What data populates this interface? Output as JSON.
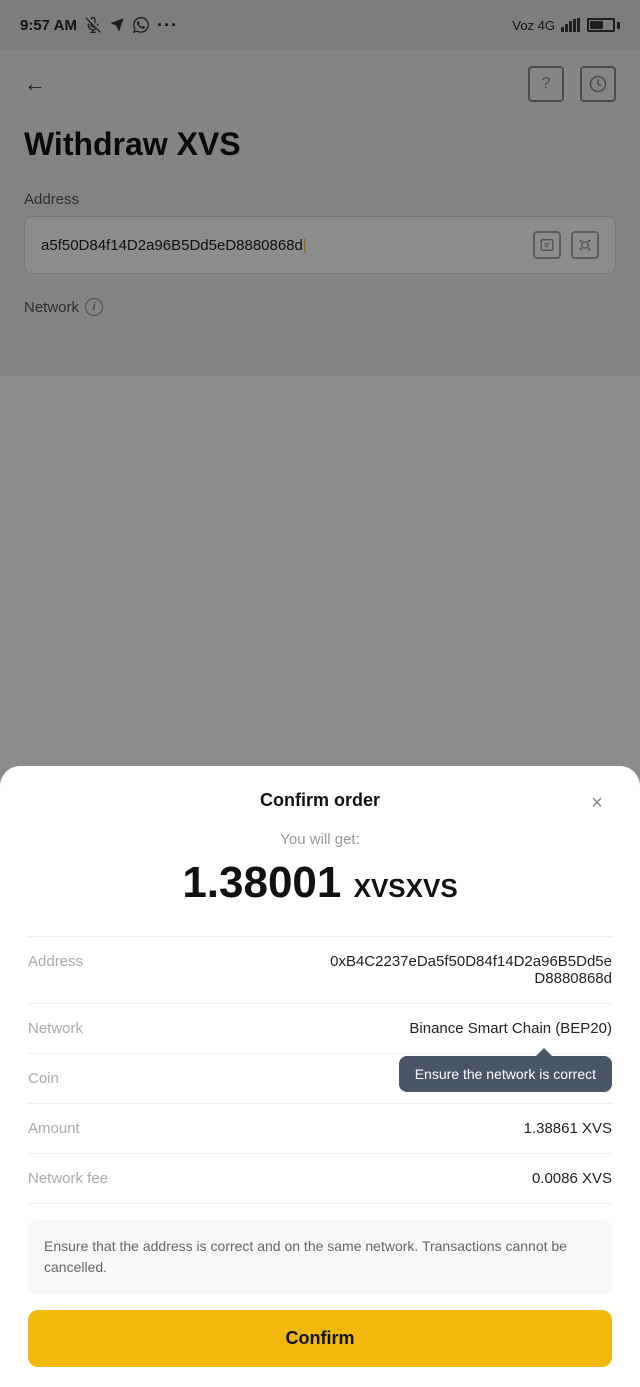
{
  "statusBar": {
    "time": "9:57 AM",
    "carrier": "Voz 4G",
    "battery": "60"
  },
  "page": {
    "title": "Withdraw XVS",
    "addressLabel": "Address",
    "addressValue": "a5f50D84f14D2a96B5Dd5eD8880868d",
    "networkLabel": "Network",
    "infoIcon": "i"
  },
  "modal": {
    "title": "Confirm order",
    "closeLabel": "×",
    "youWillGet": "You will get:",
    "amount": "1.38001",
    "currency": "XVS",
    "rows": [
      {
        "key": "Address",
        "value": "0xB4C2237eDa5f50D84f14D2a96B5Dd5eD8880868d"
      },
      {
        "key": "Network",
        "value": "Binance Smart Chain (BEP20)"
      },
      {
        "key": "Coin",
        "value": "XVS"
      },
      {
        "key": "Amount",
        "value": "1.38861 XVS"
      },
      {
        "key": "Network fee",
        "value": "0.0086 XVS"
      }
    ],
    "tooltip": "Ensure the network is correct",
    "warningText": "Ensure that the address is correct and on the same network. Transactions cannot be cancelled.",
    "confirmLabel": "Confirm"
  }
}
